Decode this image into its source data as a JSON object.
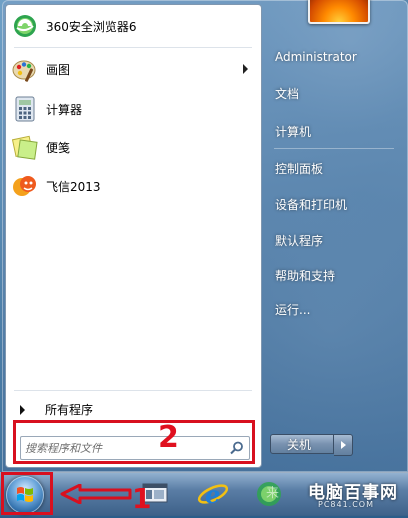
{
  "start_menu": {
    "pinned_programs": [
      {
        "label": "360安全浏览器6",
        "icon": "360-browser-icon",
        "has_submenu": false
      },
      {
        "label": "画图",
        "icon": "paint-icon",
        "has_submenu": true
      },
      {
        "label": "计算器",
        "icon": "calculator-icon",
        "has_submenu": false
      },
      {
        "label": "便笺",
        "icon": "sticky-notes-icon",
        "has_submenu": false
      },
      {
        "label": "飞信2013",
        "icon": "fetion-icon",
        "has_submenu": false
      }
    ],
    "all_programs_label": "所有程序",
    "search": {
      "placeholder": "搜索程序和文件",
      "value": ""
    },
    "right_items": [
      "Administrator",
      "文档",
      "计算机",
      "控制面板",
      "设备和打印机",
      "默认程序",
      "帮助和支持",
      "运行..."
    ],
    "shutdown_label": "关机"
  },
  "taskbar": {
    "watermark": "电脑百事网",
    "watermark_url": "PC841.COM",
    "ghost_text": "来"
  },
  "annotations": {
    "label_1": "1",
    "label_2": "2",
    "highlight_color": "#d8101f"
  }
}
